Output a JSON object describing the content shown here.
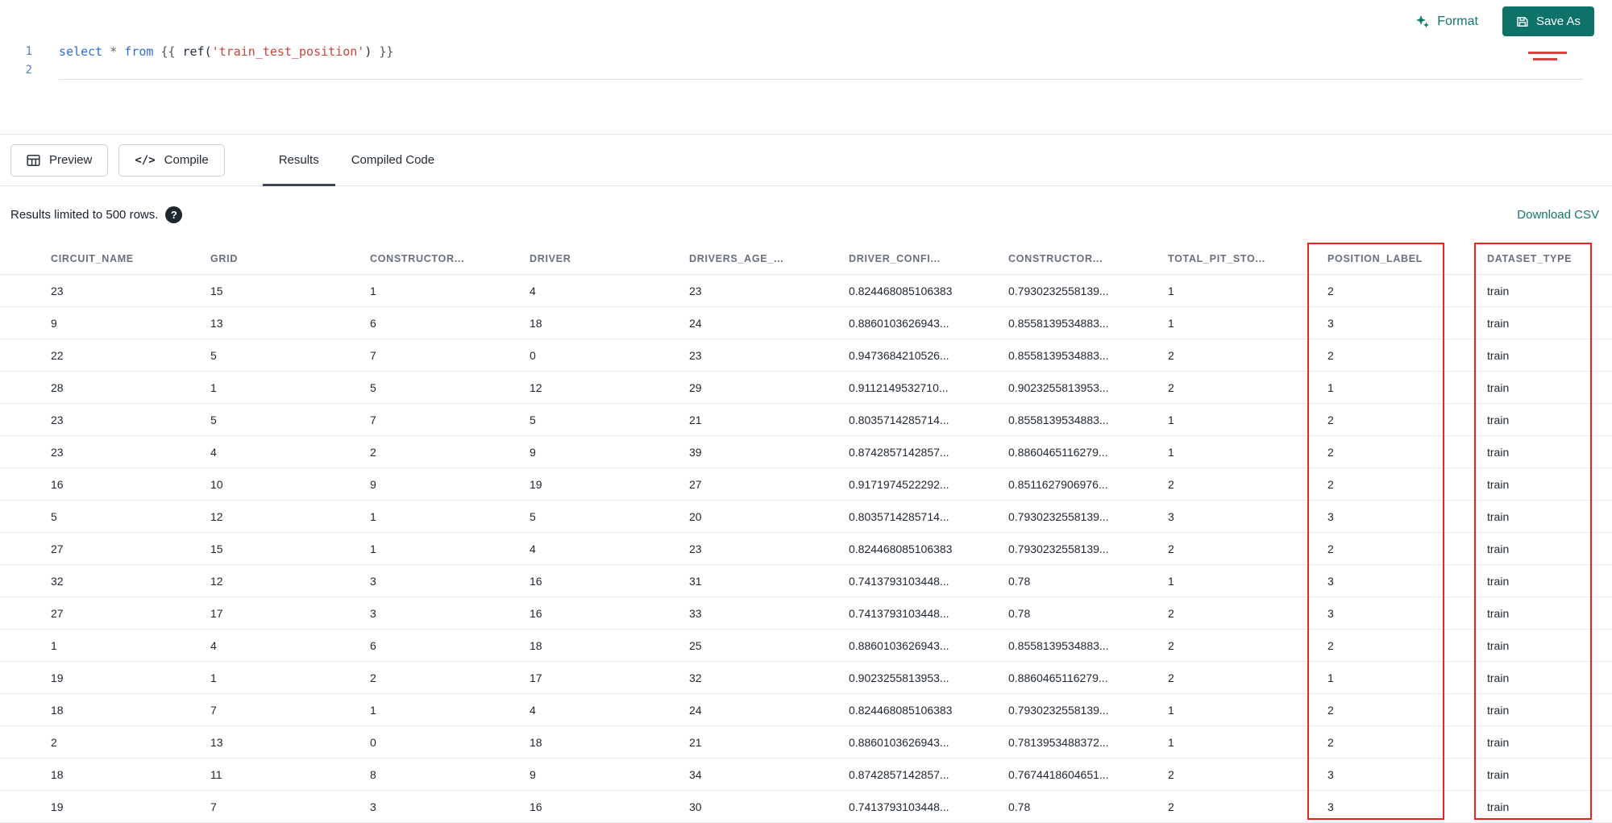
{
  "editor": {
    "lines": [
      {
        "number": "1",
        "tokens": [
          {
            "text": "select",
            "type": "keyword"
          },
          {
            "text": " ",
            "type": "plain"
          },
          {
            "text": "*",
            "type": "op"
          },
          {
            "text": " ",
            "type": "plain"
          },
          {
            "text": "from",
            "type": "keyword"
          },
          {
            "text": " ",
            "type": "plain"
          },
          {
            "text": "{{ ",
            "type": "jinja"
          },
          {
            "text": "ref(",
            "type": "fn"
          },
          {
            "text": "'train_test_position'",
            "type": "string"
          },
          {
            "text": ")",
            "type": "fn"
          },
          {
            "text": " }}",
            "type": "jinja"
          }
        ]
      },
      {
        "number": "2",
        "tokens": []
      }
    ]
  },
  "toolbar": {
    "format": {
      "label": "Format",
      "icon": "sparkles-icon"
    },
    "save_as": {
      "label": "Save As",
      "icon": "save-icon"
    }
  },
  "actions": {
    "preview": {
      "label": "Preview",
      "icon": "table-icon"
    },
    "compile": {
      "label": "Compile",
      "icon": "code-icon",
      "icon_glyph": "</>"
    }
  },
  "tabs": [
    {
      "label": "Results",
      "active": true
    },
    {
      "label": "Compiled Code",
      "active": false
    }
  ],
  "results": {
    "limit_text": "Results limited to 500 rows.",
    "help_icon_glyph": "?",
    "download_label": "Download CSV"
  },
  "table": {
    "columns": [
      "CIRCUIT_NAME",
      "GRID",
      "CONSTRUCTOR...",
      "DRIVER",
      "DRIVERS_AGE_...",
      "DRIVER_CONFI...",
      "CONSTRUCTOR...",
      "TOTAL_PIT_STO...",
      "POSITION_LABEL",
      "DATASET_TYPE"
    ],
    "rows": [
      [
        "23",
        "15",
        "1",
        "4",
        "23",
        "0.824468085106383",
        "0.7930232558139...",
        "1",
        "2",
        "train"
      ],
      [
        "9",
        "13",
        "6",
        "18",
        "24",
        "0.8860103626943...",
        "0.8558139534883...",
        "1",
        "3",
        "train"
      ],
      [
        "22",
        "5",
        "7",
        "0",
        "23",
        "0.9473684210526...",
        "0.8558139534883...",
        "2",
        "2",
        "train"
      ],
      [
        "28",
        "1",
        "5",
        "12",
        "29",
        "0.9112149532710...",
        "0.9023255813953...",
        "2",
        "1",
        "train"
      ],
      [
        "23",
        "5",
        "7",
        "5",
        "21",
        "0.8035714285714...",
        "0.8558139534883...",
        "1",
        "2",
        "train"
      ],
      [
        "23",
        "4",
        "2",
        "9",
        "39",
        "0.8742857142857...",
        "0.8860465116279...",
        "1",
        "2",
        "train"
      ],
      [
        "16",
        "10",
        "9",
        "19",
        "27",
        "0.9171974522292...",
        "0.8511627906976...",
        "2",
        "2",
        "train"
      ],
      [
        "5",
        "12",
        "1",
        "5",
        "20",
        "0.8035714285714...",
        "0.7930232558139...",
        "3",
        "3",
        "train"
      ],
      [
        "27",
        "15",
        "1",
        "4",
        "23",
        "0.824468085106383",
        "0.7930232558139...",
        "2",
        "2",
        "train"
      ],
      [
        "32",
        "12",
        "3",
        "16",
        "31",
        "0.7413793103448...",
        "0.78",
        "1",
        "3",
        "train"
      ],
      [
        "27",
        "17",
        "3",
        "16",
        "33",
        "0.7413793103448...",
        "0.78",
        "2",
        "3",
        "train"
      ],
      [
        "1",
        "4",
        "6",
        "18",
        "25",
        "0.8860103626943...",
        "0.8558139534883...",
        "2",
        "2",
        "train"
      ],
      [
        "19",
        "1",
        "2",
        "17",
        "32",
        "0.9023255813953...",
        "0.8860465116279...",
        "2",
        "1",
        "train"
      ],
      [
        "18",
        "7",
        "1",
        "4",
        "24",
        "0.824468085106383",
        "0.7930232558139...",
        "1",
        "2",
        "train"
      ],
      [
        "2",
        "13",
        "0",
        "18",
        "21",
        "0.8860103626943...",
        "0.7813953488372...",
        "1",
        "2",
        "train"
      ],
      [
        "18",
        "11",
        "8",
        "9",
        "34",
        "0.8742857142857...",
        "0.7674418604651...",
        "2",
        "3",
        "train"
      ],
      [
        "19",
        "7",
        "3",
        "16",
        "30",
        "0.7413793103448...",
        "0.78",
        "2",
        "3",
        "train"
      ]
    ]
  },
  "annotations": {
    "color": "#e8241c",
    "highlighted_columns": [
      "POSITION_LABEL",
      "DATASET_TYPE"
    ]
  },
  "colors": {
    "accent_teal": "#0f7268",
    "link_teal": "#12756c",
    "keyword_blue": "#2f6bd8",
    "string_red": "#c4473a",
    "annotation_red": "#e8241c"
  }
}
